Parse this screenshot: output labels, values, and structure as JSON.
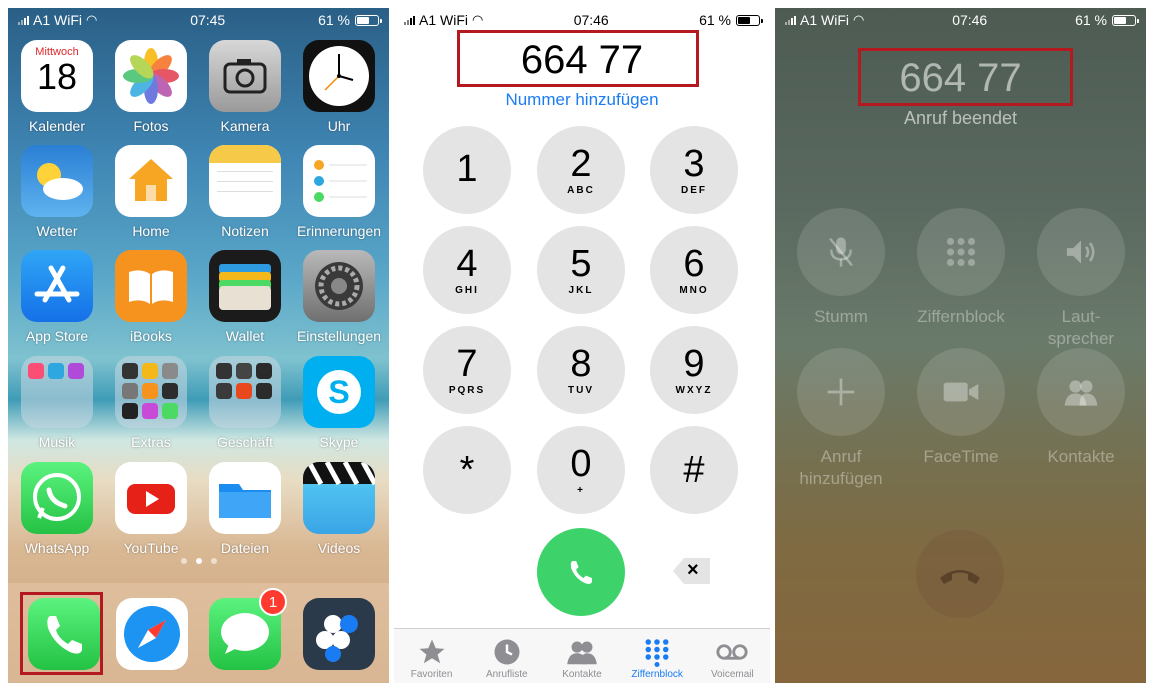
{
  "home": {
    "status": {
      "carrier": "A1 WiFi",
      "time": "07:45",
      "battery": "61 %"
    },
    "apps": [
      {
        "label": "Kalender",
        "icon": "calendar-icon",
        "weekday": "Mittwoch",
        "day": "18"
      },
      {
        "label": "Fotos",
        "icon": "photos-icon"
      },
      {
        "label": "Kamera",
        "icon": "camera-icon"
      },
      {
        "label": "Uhr",
        "icon": "clock-icon"
      },
      {
        "label": "Wetter",
        "icon": "weather-icon"
      },
      {
        "label": "Home",
        "icon": "home-icon"
      },
      {
        "label": "Notizen",
        "icon": "notes-icon"
      },
      {
        "label": "Erinnerungen",
        "icon": "reminders-icon"
      },
      {
        "label": "App Store",
        "icon": "app-store-icon"
      },
      {
        "label": "iBooks",
        "icon": "ibooks-icon"
      },
      {
        "label": "Wallet",
        "icon": "wallet-icon"
      },
      {
        "label": "Einstellungen",
        "icon": "settings-icon"
      },
      {
        "label": "Musik",
        "icon": "folder-icon"
      },
      {
        "label": "Extras",
        "icon": "folder-icon"
      },
      {
        "label": "Geschäft",
        "icon": "folder-icon"
      },
      {
        "label": "Skype",
        "icon": "skype-icon"
      },
      {
        "label": "WhatsApp",
        "icon": "whatsapp-icon"
      },
      {
        "label": "YouTube",
        "icon": "youtube-icon"
      },
      {
        "label": "Dateien",
        "icon": "files-icon"
      },
      {
        "label": "Videos",
        "icon": "videos-icon"
      }
    ],
    "dock": [
      {
        "icon": "phone-icon"
      },
      {
        "icon": "safari-icon"
      },
      {
        "icon": "messages-icon",
        "badge": "1"
      },
      {
        "icon": "blackberry-icon"
      }
    ],
    "highlight_color": "#b3191f"
  },
  "dialer": {
    "status": {
      "carrier": "A1 WiFi",
      "time": "07:46",
      "battery": "61 %"
    },
    "number": "664 77",
    "add_number": "Nummer hinzufügen",
    "keys": [
      {
        "digit": "1",
        "letters": ""
      },
      {
        "digit": "2",
        "letters": "ABC"
      },
      {
        "digit": "3",
        "letters": "DEF"
      },
      {
        "digit": "4",
        "letters": "GHI"
      },
      {
        "digit": "5",
        "letters": "JKL"
      },
      {
        "digit": "6",
        "letters": "MNO"
      },
      {
        "digit": "7",
        "letters": "PQRS"
      },
      {
        "digit": "8",
        "letters": "TUV"
      },
      {
        "digit": "9",
        "letters": "WXYZ"
      },
      {
        "digit": "*",
        "letters": ""
      },
      {
        "digit": "0",
        "letters": "+"
      },
      {
        "digit": "#",
        "letters": ""
      }
    ],
    "backspace_glyph": "×",
    "tabs": [
      {
        "label": "Favoriten",
        "icon": "star-icon"
      },
      {
        "label": "Anrufliste",
        "icon": "recents-icon"
      },
      {
        "label": "Kontakte",
        "icon": "contacts-icon"
      },
      {
        "label": "Ziffernblock",
        "icon": "keypad-icon",
        "active": true
      },
      {
        "label": "Voicemail",
        "icon": "voicemail-icon"
      }
    ],
    "accent_color": "#1a7cf2",
    "call_color": "#3dd36a"
  },
  "ended": {
    "status": {
      "carrier": "A1 WiFi",
      "time": "07:46",
      "battery": "61 %"
    },
    "number": "664 77",
    "status_text": "Anruf beendet",
    "controls": [
      {
        "label": "Stumm",
        "icon": "mute-icon"
      },
      {
        "label": "Ziffernblock",
        "icon": "keypad-icon"
      },
      {
        "label": "Laut-\nsprecher",
        "icon": "speaker-icon"
      },
      {
        "label": "Anruf\nhinzufügen",
        "icon": "add-call-icon"
      },
      {
        "label": "FaceTime",
        "icon": "facetime-icon"
      },
      {
        "label": "Kontakte",
        "icon": "contacts-icon"
      }
    ]
  }
}
